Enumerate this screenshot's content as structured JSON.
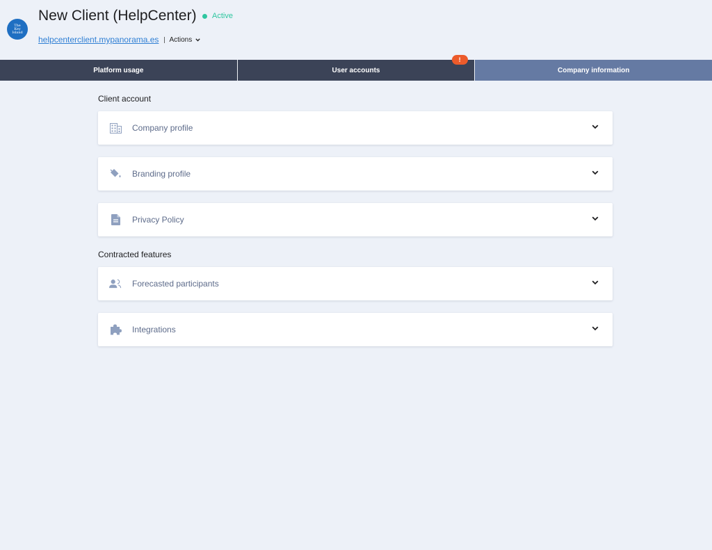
{
  "header": {
    "logo_text": "The\nKey\nIsland",
    "title": "New Client (HelpCenter)",
    "status": "Active",
    "url": "helpcenterclient.mypanorama.es",
    "actions_label": "Actions"
  },
  "tabs": [
    {
      "label": "Platform usage",
      "active": false
    },
    {
      "label": "User accounts",
      "active": false,
      "badge": "!"
    },
    {
      "label": "Company information",
      "active": true
    }
  ],
  "sections": {
    "client_account": {
      "title": "Client account",
      "items": [
        {
          "label": "Company profile",
          "icon": "building-icon"
        },
        {
          "label": "Branding profile",
          "icon": "paint-bucket-icon"
        },
        {
          "label": "Privacy Policy",
          "icon": "document-icon"
        }
      ]
    },
    "contracted_features": {
      "title": "Contracted features",
      "items": [
        {
          "label": "Forecasted participants",
          "icon": "participants-icon"
        },
        {
          "label": "Integrations",
          "icon": "puzzle-icon"
        }
      ]
    }
  },
  "colors": {
    "background": "#edf1f8",
    "tab_dark": "#3b4357",
    "tab_active": "#657aa3",
    "status_green": "#2fc6a0",
    "badge_orange": "#ec5b2b",
    "link_blue": "#2f7fd4"
  }
}
